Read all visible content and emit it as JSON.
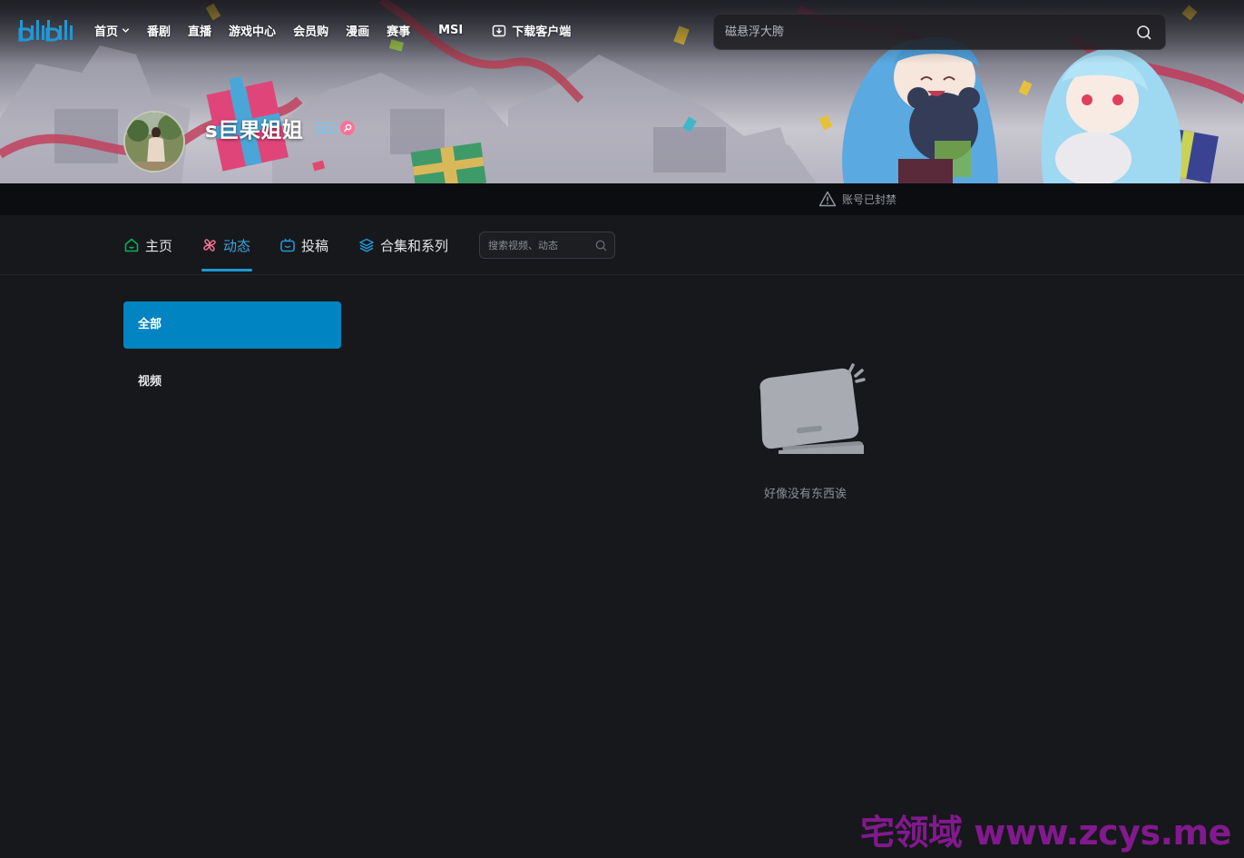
{
  "header": {
    "logo_text": "bilibili",
    "nav": [
      {
        "label": "首页",
        "has_dropdown": true
      },
      {
        "label": "番剧"
      },
      {
        "label": "直播"
      },
      {
        "label": "游戏中心"
      },
      {
        "label": "会员购"
      },
      {
        "label": "漫画"
      },
      {
        "label": "赛事"
      },
      {
        "label": "MSI"
      },
      {
        "label": "下载客户端",
        "icon": "download-icon"
      }
    ],
    "search": {
      "placeholder": "磁悬浮大胯",
      "icon": "search-icon"
    }
  },
  "profile": {
    "username": "s巨果姐姐",
    "level": "LV3",
    "badge_color": "#fb7299"
  },
  "ban_notice": {
    "text": "账号已封禁",
    "icon": "warning-icon"
  },
  "tabs": [
    {
      "label": "主页",
      "icon": "home-icon",
      "color": "#00b15b"
    },
    {
      "label": "动态",
      "icon": "dynamic-icon",
      "active": true,
      "color": "#fb7299"
    },
    {
      "label": "投稿",
      "icon": "tv-icon",
      "color": "#1e98d7"
    },
    {
      "label": "合集和系列",
      "icon": "layers-icon",
      "color": "#1e98d7"
    }
  ],
  "tab_search": {
    "placeholder": "搜索视频、动态"
  },
  "filters": {
    "all": "全部",
    "video": "视频"
  },
  "empty_state": {
    "text": "好像没有东西诶"
  },
  "watermark": "宅领域 www.zcys.me",
  "colors": {
    "accent": "#0084c2",
    "background": "#17181b",
    "active_tab": "#3aa7e0"
  }
}
